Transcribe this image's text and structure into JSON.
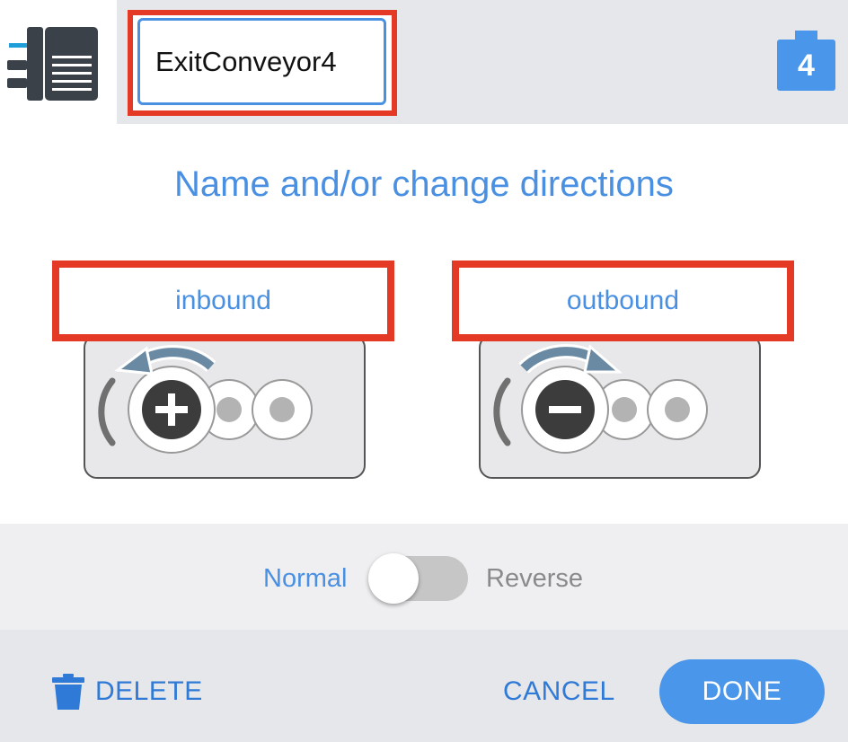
{
  "header": {
    "device_icon": "conveyor-device-icon",
    "name_value": "ExitConveyor4",
    "port_number": "4",
    "port_icon": "port-badge-icon"
  },
  "dialog": {
    "title": "Name and/or change directions",
    "inbound": {
      "label": "inbound",
      "icon": "motor-rotate-counterclockwise-plus-icon"
    },
    "outbound": {
      "label": "outbound",
      "icon": "motor-rotate-clockwise-minus-icon"
    }
  },
  "direction_toggle": {
    "left_label": "Normal",
    "right_label": "Reverse",
    "reversed": false
  },
  "footer": {
    "delete_label": "DELETE",
    "delete_icon": "trash-icon",
    "cancel_label": "CANCEL",
    "done_label": "DONE"
  },
  "colors": {
    "accent_blue": "#4a90e2",
    "button_blue": "#4a96ea",
    "highlight_red": "#e43a25",
    "header_gray": "#e6e7eb"
  }
}
